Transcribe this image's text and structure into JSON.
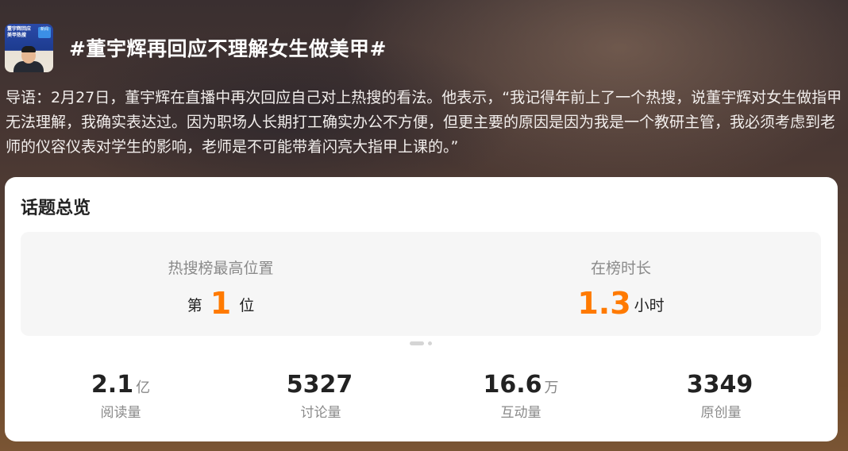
{
  "topic": {
    "thumbnail_caption": "董宇辉回应美甲热搜",
    "thumbnail_badge": "新闻",
    "title": "#董宇辉再回应不理解女生做美甲#",
    "intro": "导语：2月27日，董宇辉在直播中再次回应自己对上热搜的看法。他表示，“我记得年前上了一个热搜，说董宇辉对女生做指甲无法理解，我确实表达过。因为职场人长期打工确实办公不方便，但更主要的原因是因为我是一个教研主管，我必须考虑到老师的仪容仪表对学生的影响，老师是不可能带着闪亮大指甲上课的。”"
  },
  "overview": {
    "title": "话题总览",
    "rank": {
      "label": "热搜榜最高位置",
      "prefix": "第",
      "value": "1",
      "suffix": "位"
    },
    "duration": {
      "label": "在榜时长",
      "value": "1.3",
      "suffix": "小时"
    },
    "stats": [
      {
        "value": "2.1",
        "unit": "亿",
        "label": "阅读量"
      },
      {
        "value": "5327",
        "unit": "",
        "label": "讨论量"
      },
      {
        "value": "16.6",
        "unit": "万",
        "label": "互动量"
      },
      {
        "value": "3349",
        "unit": "",
        "label": "原创量"
      }
    ]
  },
  "colors": {
    "accent": "#ff7a00",
    "card_background": "#ffffff",
    "summary_background": "#f6f6f6"
  }
}
